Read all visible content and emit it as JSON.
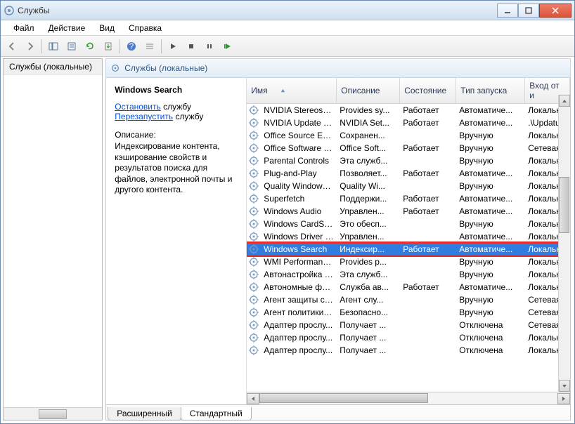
{
  "titlebar": {
    "title": "Службы"
  },
  "menu": {
    "file": "Файл",
    "action": "Действие",
    "view": "Вид",
    "help": "Справка"
  },
  "left_tree": {
    "root": "Службы (локальные)"
  },
  "pane_header": "Службы (локальные)",
  "info": {
    "name": "Windows Search",
    "stop_link": "Остановить",
    "stop_suffix": " службу",
    "restart_link": "Перезапустить",
    "restart_suffix": " службу",
    "desc_label": "Описание:",
    "desc_text": "Индексирование контента, кэширование свойств и результатов поиска для файлов, электронной почты и другого контента."
  },
  "columns": {
    "name": "Имя",
    "desc": "Описание",
    "state": "Состояние",
    "start": "Тип запуска",
    "logon": "Вход от и"
  },
  "rows": [
    {
      "name": "NVIDIA Stereosco...",
      "desc": "Provides sy...",
      "state": "Работает",
      "start": "Автоматиче...",
      "logon": "Локальн"
    },
    {
      "name": "NVIDIA Update Se...",
      "desc": "NVIDIA Set...",
      "state": "Работает",
      "start": "Автоматиче...",
      "logon": ".\\Updatu"
    },
    {
      "name": "Office  Source Eng...",
      "desc": "Сохранен...",
      "state": "",
      "start": "Вручную",
      "logon": "Локальн"
    },
    {
      "name": "Office Software Pr...",
      "desc": "Office Soft...",
      "state": "Работает",
      "start": "Вручную",
      "logon": "Сетевая с"
    },
    {
      "name": "Parental Controls",
      "desc": "Эта служб...",
      "state": "",
      "start": "Вручную",
      "logon": "Локальн"
    },
    {
      "name": "Plug-and-Play",
      "desc": "Позволяет...",
      "state": "Работает",
      "start": "Автоматиче...",
      "logon": "Локальн"
    },
    {
      "name": "Quality Windows ...",
      "desc": "Quality Wi...",
      "state": "",
      "start": "Вручную",
      "logon": "Локальн"
    },
    {
      "name": "Superfetch",
      "desc": "Поддержи...",
      "state": "Работает",
      "start": "Автоматиче...",
      "logon": "Локальн"
    },
    {
      "name": "Windows Audio",
      "desc": "Управлен...",
      "state": "Работает",
      "start": "Автоматиче...",
      "logon": "Локальн"
    },
    {
      "name": "Windows CardSpa...",
      "desc": "Это обесп...",
      "state": "",
      "start": "Вручную",
      "logon": "Локальн"
    },
    {
      "name": "Windows Driver F...",
      "desc": "Управлен...",
      "state": "",
      "start": "Автоматиче...",
      "logon": "Локальн"
    },
    {
      "name": "Windows Search",
      "desc": "Индексир...",
      "state": "Работает",
      "start": "Автоматиче...",
      "logon": "Локальн",
      "selected": true,
      "hilite": true
    },
    {
      "name": "WMI Performance...",
      "desc": "Provides p...",
      "state": "",
      "start": "Вручную",
      "logon": "Локальн"
    },
    {
      "name": "Автонастройка W...",
      "desc": "Эта служб...",
      "state": "",
      "start": "Вручную",
      "logon": "Локальн"
    },
    {
      "name": "Автономные фай...",
      "desc": "Служба ав...",
      "state": "Работает",
      "start": "Автоматиче...",
      "logon": "Локальн"
    },
    {
      "name": "Агент защиты сет...",
      "desc": "Агент слу...",
      "state": "",
      "start": "Вручную",
      "logon": "Сетевая с"
    },
    {
      "name": "Агент политики I...",
      "desc": "Безопасно...",
      "state": "",
      "start": "Вручную",
      "logon": "Сетевая с"
    },
    {
      "name": "Адаптер прослу...",
      "desc": "Получает ...",
      "state": "",
      "start": "Отключена",
      "logon": "Сетевая с"
    },
    {
      "name": "Адаптер прослу...",
      "desc": "Получает ...",
      "state": "",
      "start": "Отключена",
      "logon": "Локальн"
    },
    {
      "name": "Адаптер прослу...",
      "desc": "Получает ...",
      "state": "",
      "start": "Отключена",
      "logon": "Локальн"
    }
  ],
  "tabs": {
    "extended": "Расширенный",
    "standard": "Стандартный"
  }
}
